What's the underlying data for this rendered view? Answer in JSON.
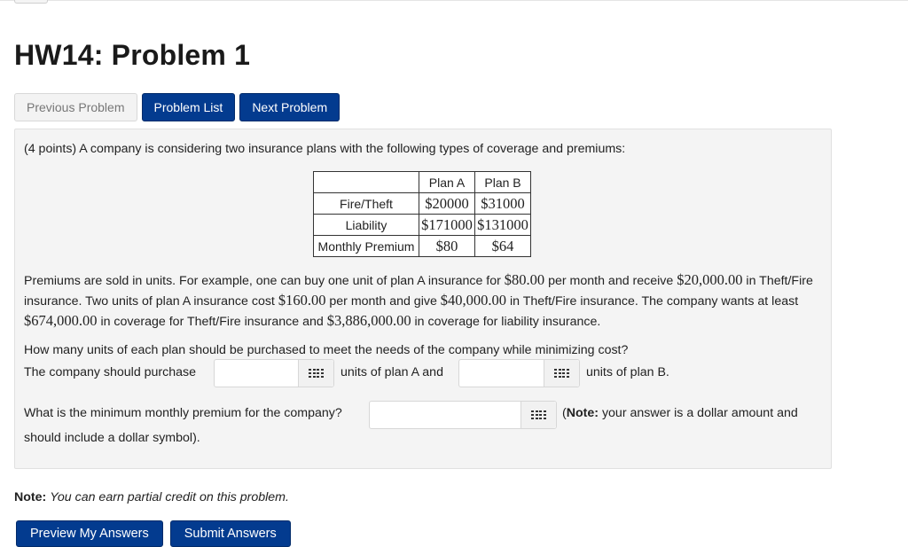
{
  "title": "HW14: Problem 1",
  "nav": {
    "previous": "Previous Problem",
    "list": "Problem List",
    "next": "Next Problem"
  },
  "problem": {
    "intro": "(4 points) A company is considering two insurance plans with the following types of coverage and premiums:",
    "table": {
      "header": [
        "",
        "Plan A",
        "Plan B"
      ],
      "rows": [
        {
          "label": "Fire/Theft",
          "a": "$20000",
          "b": "$31000"
        },
        {
          "label": "Liability",
          "a": "$171000",
          "b": "$131000"
        },
        {
          "label": "Monthly Premium",
          "a": "$80",
          "b": "$64"
        }
      ]
    },
    "para": {
      "t1": "Premiums are sold in units. For example, one can buy one unit of plan A insurance for ",
      "m1": "$80.00",
      "t2": " per month and receive ",
      "m2": "$20,000.00",
      "t3": " in Theft/Fire insurance. Two units of plan A insurance cost ",
      "m3": "$160.00",
      "t4": " per month and give ",
      "m4": "$40,000.00",
      "t5": " in Theft/Fire insurance. The company wants at least ",
      "m5": "$674,000.00",
      "t6": " in coverage for Theft/Fire insurance and ",
      "m6": "$3,886,000.00",
      "t7": " in coverage for liability insurance."
    },
    "question1": "How many units of each plan should be purchased to meet the needs of the company while minimizing cost?",
    "q2_prefix": "The company should purchase",
    "q2_mid": "units of plan A and",
    "q2_suffix": "units of plan B.",
    "answer_a": "",
    "answer_b": "",
    "question3": "What is the minimum monthly premium for the company?",
    "answer_c": "",
    "note_label": "Note:",
    "note_rest": " your answer is a dollar amount and",
    "q3_cont": "should include a dollar symbol)."
  },
  "note": {
    "label": "Note:",
    "text": "You can earn partial credit on this problem."
  },
  "actions": {
    "preview": "Preview My Answers",
    "submit": "Submit Answers"
  },
  "icons": {
    "equation_editor": "grid-icon"
  },
  "colors": {
    "primary": "#033b8f",
    "panel": "#f4f4f4"
  }
}
